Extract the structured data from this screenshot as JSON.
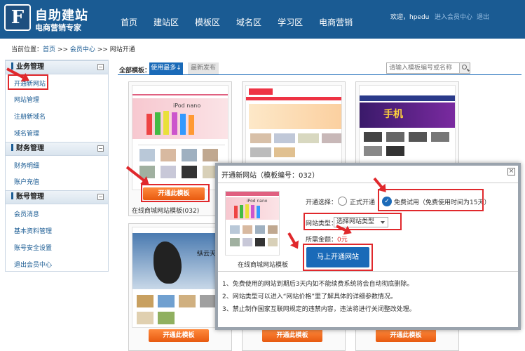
{
  "header": {
    "logo_letter": "F",
    "logo_name": "自助建站",
    "logo_sub": "电商营销专家",
    "nav": [
      "首页",
      "建站区",
      "模板区",
      "域名区",
      "学习区",
      "电商营销"
    ],
    "welcome": "欢迎，hpedu",
    "member_center": "进入会员中心",
    "logout": "退出"
  },
  "breadcrumb": {
    "prefix": "当前位置：",
    "home": "首页",
    "sep": ">>",
    "member": "会员中心",
    "current": "网站开通"
  },
  "sidebar": {
    "groups": [
      {
        "title": "业务管理",
        "items": [
          "开通新网站",
          "网站管理",
          "注册新域名",
          "域名管理"
        ]
      },
      {
        "title": "财务管理",
        "items": [
          "财务明细",
          "账户充值"
        ]
      },
      {
        "title": "账号管理",
        "items": [
          "会员消息",
          "基本资料管理",
          "账号安全设置",
          "退出会员中心"
        ]
      }
    ],
    "collapse_symbol": "−"
  },
  "templates": {
    "label": "全部模板：",
    "tab_most_used": "使用最多↓",
    "tab_latest": "最新发布",
    "search_placeholder": "请输入模板编号或名称",
    "open_button": "开通此模板",
    "first_caption": "在线商城网站模板(032)",
    "card_texts": {
      "ipod_title": "iPod nano",
      "phone_banner": "手机",
      "ink_banner": "纵云天下"
    }
  },
  "modal": {
    "title": "开通新网站（模板编号：032）",
    "close": "×",
    "thumb_caption": "在线商城网站模板",
    "open_type_label": "开通选择：",
    "option_formal": "正式开通",
    "option_trial": "免费试用（免费使用时间为15天）",
    "site_type_label": "网站类型：",
    "site_type_value": "选择网站类型",
    "amount_label": "所需金额：",
    "amount_value": "0元",
    "submit": "马上开通网站",
    "notes": [
      "1、免费使用的网站到期后3天内如不能续费系统将会自动彻底删除。",
      "2、网站类型可以进入“网站价格”里了解具体的详细参数情况。",
      "3、禁止制作国家互联网规定的违禁内容，违法将进行关闭整改处理。"
    ]
  },
  "colors": {
    "header_bg": "#1a5b93",
    "accent_blue": "#1a6ab8",
    "highlight_red": "#e0282c",
    "open_orange": "#f07020"
  }
}
